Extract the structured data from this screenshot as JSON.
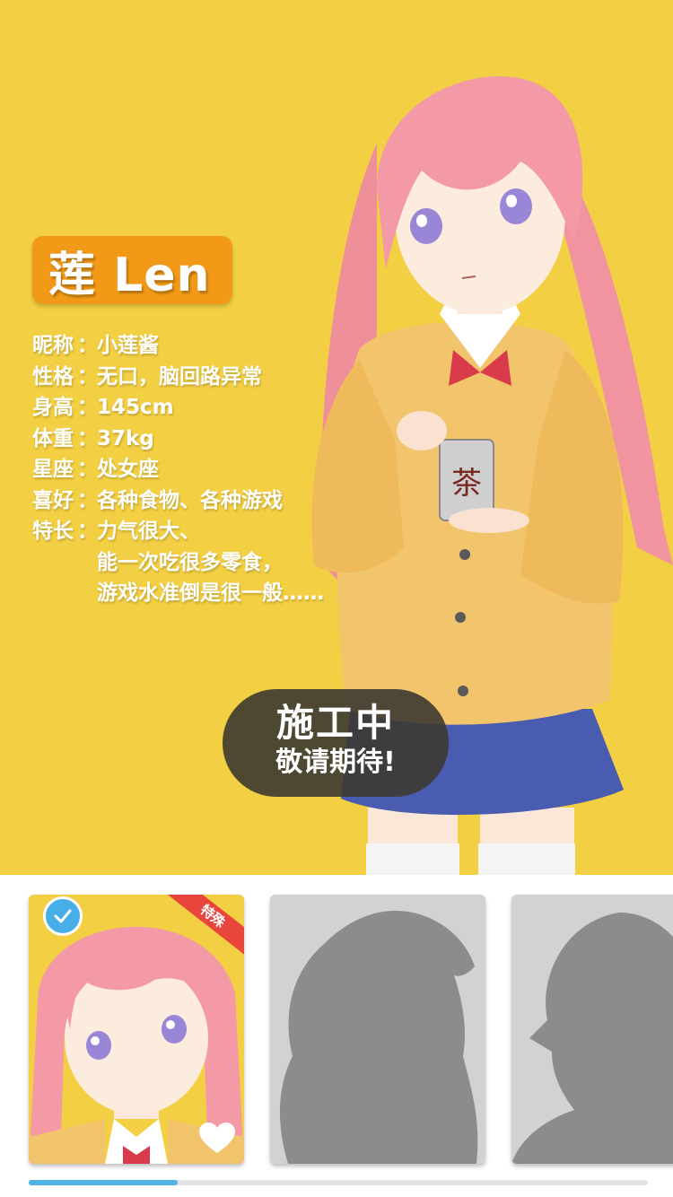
{
  "character": {
    "name": "莲 Len",
    "profile": [
      {
        "label": "昵称",
        "sep": "：",
        "value": "小莲酱"
      },
      {
        "label": "性格",
        "sep": "：",
        "value": "无口，脑回路异常"
      },
      {
        "label": "身高",
        "sep": "：",
        "value": "145cm"
      },
      {
        "label": "体重",
        "sep": "：",
        "value": "37kg"
      },
      {
        "label": "星座",
        "sep": "：",
        "value": "处女座"
      },
      {
        "label": "喜好",
        "sep": "：",
        "value": "各种食物、各种游戏"
      },
      {
        "label": "特长",
        "sep": "：",
        "value": "力气很大、"
      }
    ],
    "specialty_more": [
      "能一次吃很多零食，",
      "游戏水准倒是很一般……"
    ],
    "can_label": "茶"
  },
  "banner": {
    "title": "施工中",
    "subtitle": "敬请期待!"
  },
  "selector": {
    "cards": [
      {
        "ribbon": "特殊",
        "selected": true
      },
      {
        "locked": true
      },
      {
        "locked": true
      }
    ],
    "scroll_progress": 0.24
  },
  "colors": {
    "background": "#f3cf43",
    "badge": "#f29a17",
    "accent": "#4fb3e8",
    "ribbon": "#e8453c"
  }
}
